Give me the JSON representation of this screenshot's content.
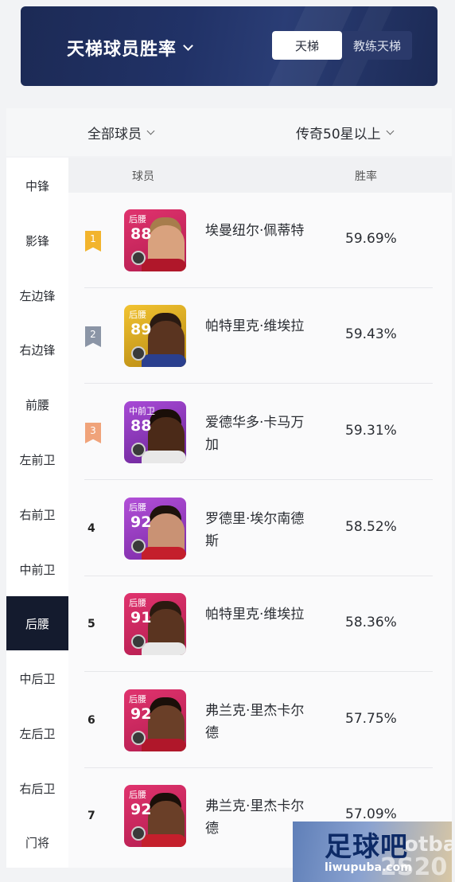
{
  "header": {
    "title": "天梯球员胜率",
    "toggle": [
      "天梯",
      "教练天梯"
    ],
    "active_toggle": "天梯"
  },
  "filters": {
    "players": "全部球员",
    "tier": "传奇50星以上"
  },
  "sidebar": {
    "items": [
      "中锋",
      "影锋",
      "左边锋",
      "右边锋",
      "前腰",
      "左前卫",
      "右前卫",
      "中前卫",
      "后腰",
      "中后卫",
      "左后卫",
      "右后卫",
      "门将"
    ],
    "active": "后腰"
  },
  "table": {
    "headers": [
      "球员",
      "胜率"
    ],
    "rows": [
      {
        "rank": "1",
        "position": "后腰",
        "rating": "88",
        "name": "埃曼纽尔·佩蒂特",
        "win_rate": "59.69%"
      },
      {
        "rank": "2",
        "position": "后腰",
        "rating": "89",
        "name": "帕特里克·维埃拉",
        "win_rate": "59.43%"
      },
      {
        "rank": "3",
        "position": "中前卫",
        "rating": "88",
        "name": "爱德华多·卡马万加",
        "win_rate": "59.31%"
      },
      {
        "rank": "4",
        "position": "后腰",
        "rating": "92",
        "name": "罗德里·埃尔南德斯",
        "win_rate": "58.52%"
      },
      {
        "rank": "5",
        "position": "后腰",
        "rating": "91",
        "name": "帕特里克·维埃拉",
        "win_rate": "58.36%"
      },
      {
        "rank": "6",
        "position": "后腰",
        "rating": "92",
        "name": "弗兰克·里杰卡尔德",
        "win_rate": "57.75%"
      },
      {
        "rank": "7",
        "position": "后腰",
        "rating": "92",
        "name": "弗兰克·里杰卡尔德",
        "win_rate": "57.09%"
      }
    ]
  },
  "watermark": {
    "name": "足球吧",
    "url": "liwupuba.com",
    "ghost_text": "otba",
    "ghost_text2": "2S20"
  },
  "colors": {
    "header_bg": "#213267",
    "active_side": "#141b2e",
    "badge_gold": "#f2b42d",
    "badge_silver": "#8b95a6",
    "badge_bronze": "#f0a37a"
  }
}
